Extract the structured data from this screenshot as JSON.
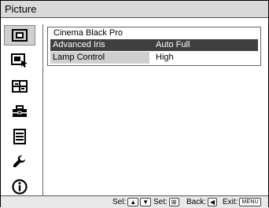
{
  "menu": {
    "title": "Picture"
  },
  "sidebar": {
    "items": [
      {
        "icon": "picture-icon",
        "active": true
      },
      {
        "icon": "advanced-picture-icon",
        "active": false
      },
      {
        "icon": "screen-icon",
        "active": false
      },
      {
        "icon": "setup-icon",
        "active": false
      },
      {
        "icon": "function-icon",
        "active": false
      },
      {
        "icon": "installation-icon",
        "active": false
      },
      {
        "icon": "information-icon",
        "active": false
      }
    ]
  },
  "panel": {
    "heading": "Cinema Black Pro",
    "rows": [
      {
        "label": "Advanced Iris",
        "value": "Auto Full"
      },
      {
        "label": "Lamp Control",
        "value": "High"
      }
    ]
  },
  "footer": {
    "sel": "Sel:",
    "set": "Set:",
    "back": "Back:",
    "exit": "Exit:",
    "menu_key": "MENU"
  }
}
